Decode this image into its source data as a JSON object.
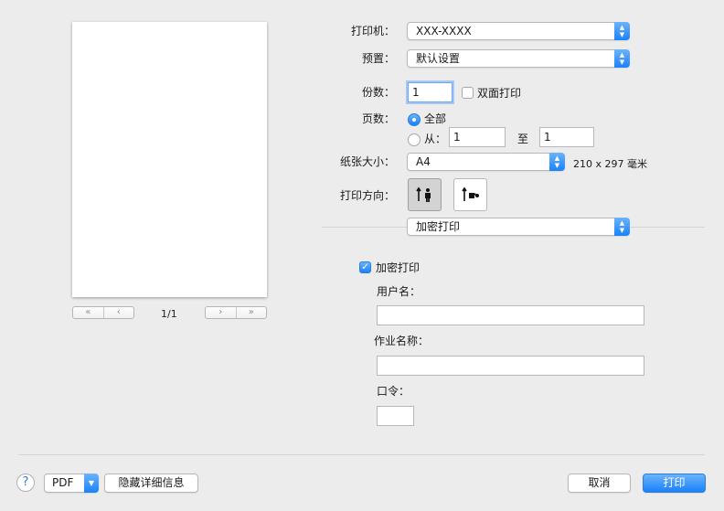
{
  "preview": {
    "first_icon": "«",
    "prev_icon": "‹",
    "next_icon": "›",
    "last_icon": "»",
    "page_indicator": "1/1"
  },
  "printer": {
    "label": "打印机：",
    "value": "XXX-XXXX"
  },
  "presets": {
    "label": "预置：",
    "value": "默认设置"
  },
  "copies": {
    "label": "份数：",
    "value": "1",
    "duplex_label": "双面打印",
    "duplex_checked": false
  },
  "pages": {
    "label": "页数：",
    "all_label": "全部",
    "from_label": "从：",
    "from_value": "1",
    "to_label": "至",
    "to_value": "1",
    "selected": "all"
  },
  "paper_size": {
    "label": "纸张大小：",
    "value": "A4",
    "dimensions": "210 x 297 毫米"
  },
  "orientation": {
    "label": "打印方向：",
    "portrait_icon": "portrait-icon",
    "landscape_icon": "landscape-icon",
    "selected": "portrait"
  },
  "panel_select": {
    "value": "加密打印"
  },
  "secure_print": {
    "checkbox_label": "加密打印",
    "checked": true,
    "username_label": "用户名：",
    "username_value": "",
    "job_name_label": "作业名称：",
    "job_name_value": "",
    "password_label": "口令：",
    "password_value": ""
  },
  "footer": {
    "help": "?",
    "pdf_label": "PDF",
    "hide_details_label": "隐藏详细信息",
    "cancel_label": "取消",
    "print_label": "打印"
  },
  "colors": {
    "accent": "#1a82fb",
    "background": "#ececec"
  }
}
